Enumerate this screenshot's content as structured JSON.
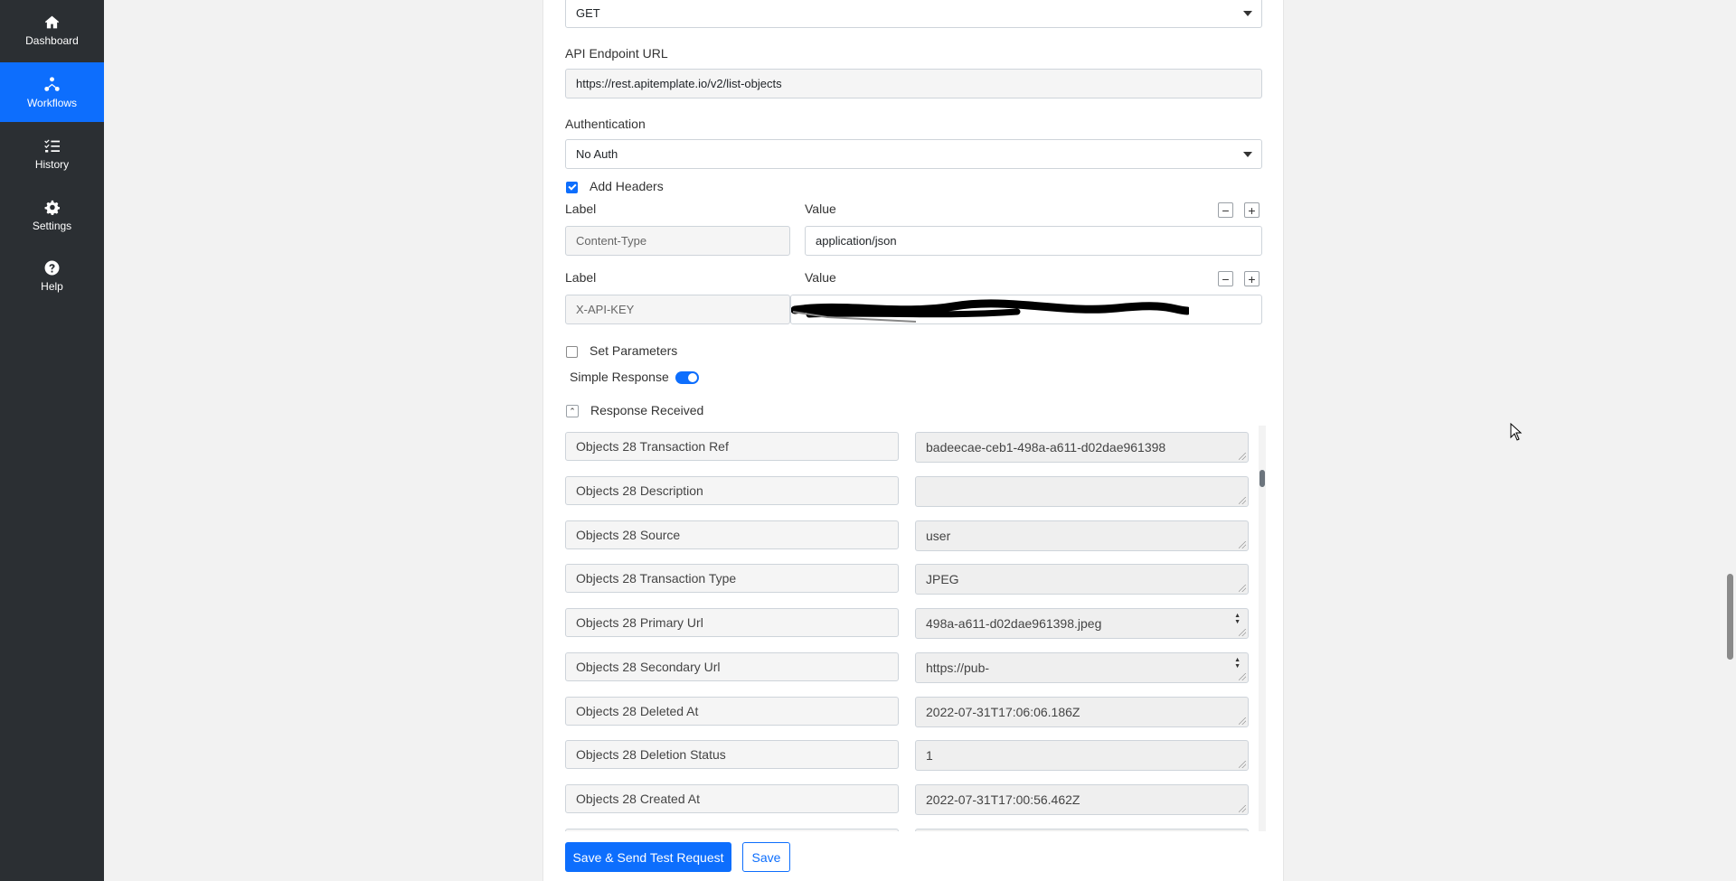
{
  "sidebar": {
    "items": [
      {
        "label": "Dashboard",
        "icon": "home-icon",
        "active": false
      },
      {
        "label": "Workflows",
        "icon": "workflow-icon",
        "active": true
      },
      {
        "label": "History",
        "icon": "list-icon",
        "active": false
      },
      {
        "label": "Settings",
        "icon": "gear-icon",
        "active": false
      },
      {
        "label": "Help",
        "icon": "question-icon",
        "active": false
      }
    ]
  },
  "form": {
    "method": {
      "value": "GET"
    },
    "endpoint": {
      "label": "API Endpoint URL",
      "value": "https://rest.apitemplate.io/v2/list-objects"
    },
    "auth": {
      "label": "Authentication",
      "value": "No Auth"
    },
    "add_headers": {
      "label": "Add Headers",
      "checked": true
    },
    "headers": [
      {
        "label_caption": "Label",
        "value_caption": "Value",
        "label": "Content-Type",
        "value": "application/json"
      },
      {
        "label_caption": "Label",
        "value_caption": "Value",
        "label": "X-API-KEY",
        "value": ""
      }
    ],
    "set_parameters": {
      "label": "Set Parameters",
      "checked": false
    },
    "simple_response": {
      "label": "Simple Response",
      "on": true
    },
    "response_received": {
      "label": "Response Received"
    }
  },
  "response": {
    "rows": [
      {
        "label": "Objects 28 Transaction Ref",
        "value": "badeecae-ceb1-498a-a611-d02dae961398"
      },
      {
        "label": "Objects 28 Description",
        "value": ""
      },
      {
        "label": "Objects 28 Source",
        "value": "user"
      },
      {
        "label": "Objects 28 Transaction Type",
        "value": "JPEG"
      },
      {
        "label": "Objects 28 Primary Url",
        "value": "498a-a611-d02dae961398.jpeg"
      },
      {
        "label": "Objects 28 Secondary Url",
        "value": "https://pub-"
      },
      {
        "label": "Objects 28 Deleted At",
        "value": "2022-07-31T17:06:06.186Z"
      },
      {
        "label": "Objects 28 Deletion Status",
        "value": "1"
      },
      {
        "label": "Objects 28 Created At",
        "value": "2022-07-31T17:00:56.462Z"
      }
    ]
  },
  "actions": {
    "save_send": "Save & Send Test Request",
    "save": "Save"
  },
  "colors": {
    "sidebar_bg": "#2b2f33",
    "accent": "#0d6efd"
  }
}
